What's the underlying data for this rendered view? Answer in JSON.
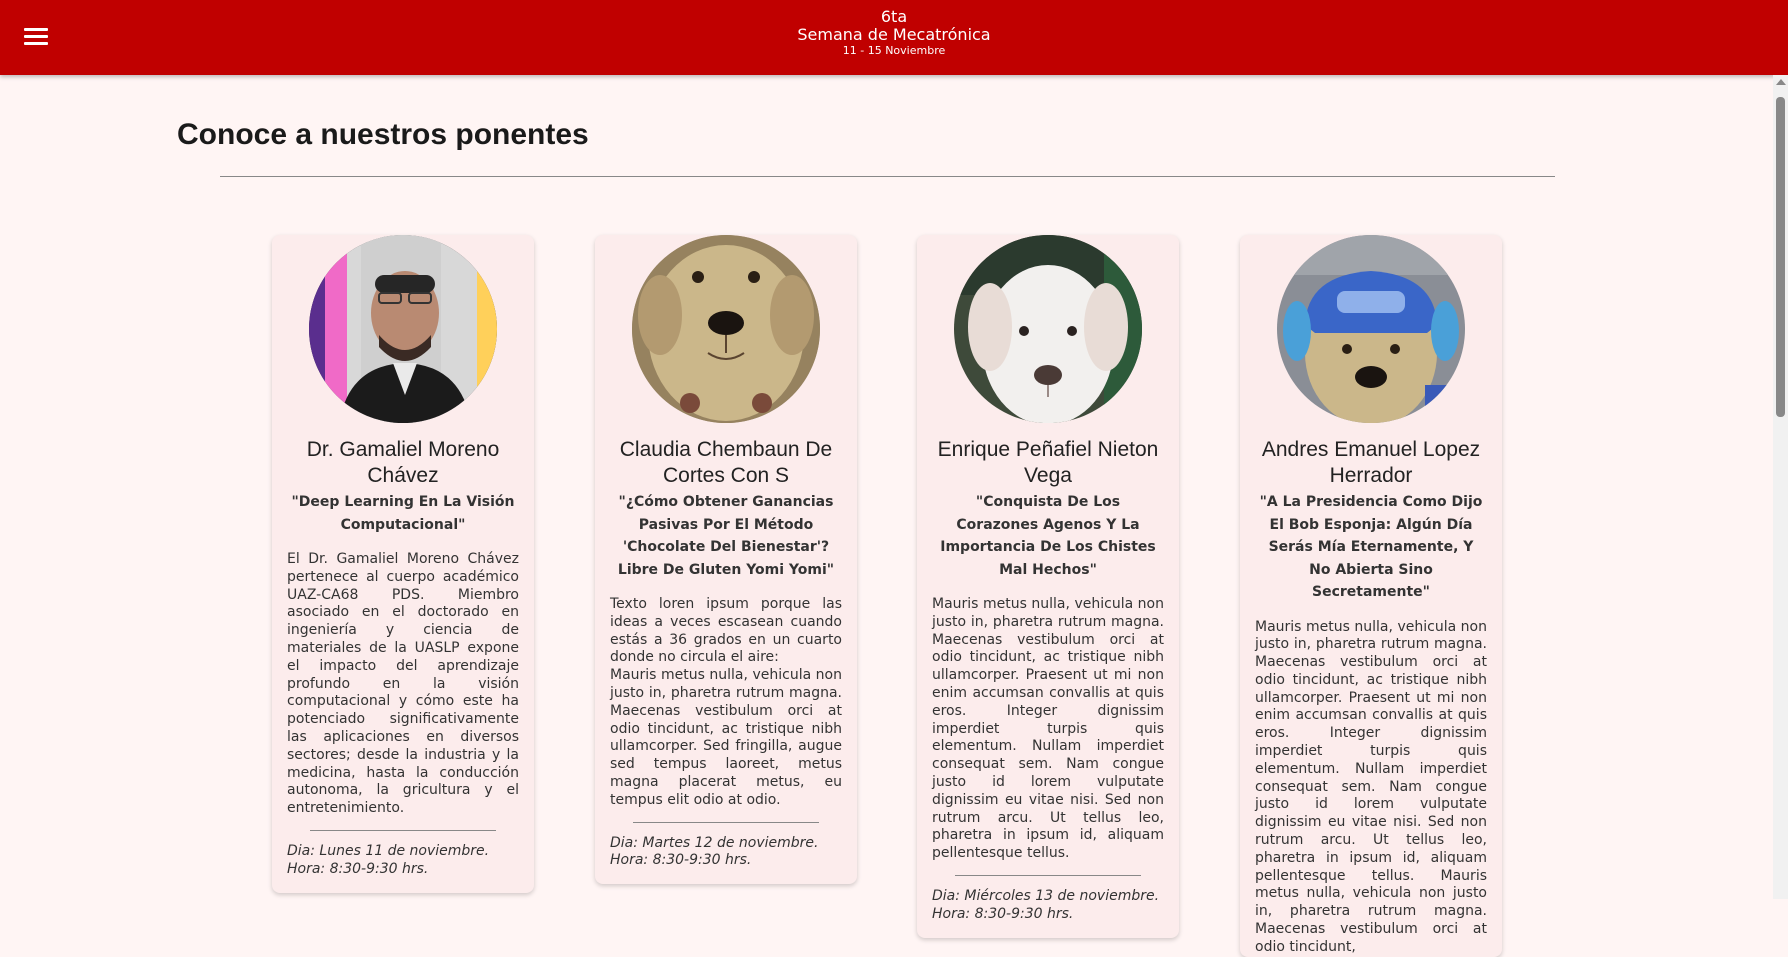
{
  "header": {
    "edition": "6ta",
    "title": "Semana de Mecatrónica",
    "dates": "11 - 15 Noviembre"
  },
  "main": {
    "title": "Conoce a nuestros ponentes"
  },
  "speakers": [
    {
      "name": "Dr. Gamaliel Moreno Chávez",
      "talk": "\"Deep Learning En La Visión Computacional\"",
      "description": "El Dr. Gamaliel Moreno Chávez pertenece al cuerpo académico UAZ-CA68 PDS. Miembro asociado en el doctorado en ingeniería y ciencia de materiales de la UASLP expone el impacto del aprendizaje profundo en la visión computacional y cómo este ha potenciado significativamente las aplicaciones en diversos sectores; desde la industria y la medicina, hasta la conducción autonoma, la gricultura y el entretenimiento.",
      "day": "Dia: Lunes 11 de noviembre.",
      "hour": "Hora: 8:30-9:30 hrs."
    },
    {
      "name": "Claudia Chembaun De Cortes Con S",
      "talk": "\"¿Cómo Obtener Ganancias Pasivas Por El Método 'Chocolate Del Bienestar'? Libre De Gluten Yomi Yomi\"",
      "description": "Texto loren ipsum porque las ideas a veces escasean cuando estás a 36 grados en un cuarto donde no circula el aire:\nMauris metus nulla, vehicula non justo in, pharetra rutrum magna. Maecenas vestibulum orci at odio tincidunt, ac tristique nibh ullamcorper. Sed fringilla, augue sed tempus laoreet, metus magna placerat metus, eu tempus elit odio at odio.",
      "day": "Dia: Martes 12 de noviembre.",
      "hour": "Hora: 8:30-9:30 hrs."
    },
    {
      "name": "Enrique Peñafiel Nieton Vega",
      "talk": "\"Conquista De Los Corazones Agenos Y La Importancia De Los Chistes Mal Hechos\"",
      "description": "Mauris metus nulla, vehicula non justo in, pharetra rutrum magna. Maecenas vestibulum orci at odio tincidunt, ac tristique nibh ullamcorper. Praesent ut mi non enim accumsan convallis at quis eros. Integer dignissim imperdiet turpis quis elementum. Nullam imperdiet consequat sem. Nam congue justo id lorem vulputate dignissim eu vitae nisi. Sed non rutrum arcu. Ut tellus leo, pharetra in ipsum id, aliquam pellentesque tellus.",
      "day": "Dia: Miércoles 13 de noviembre.",
      "hour": "Hora: 8:30-9:30 hrs."
    },
    {
      "name": "Andres Emanuel Lopez Herrador",
      "talk": "\"A La Presidencia Como Dijo El Bob Esponja: Algún Día Serás Mía Eternamente, Y No Abierta Sino Secretamente\"",
      "description": "Mauris metus nulla, vehicula non justo in, pharetra rutrum magna. Maecenas vestibulum orci at odio tincidunt, ac tristique nibh ullamcorper. Praesent ut mi non enim accumsan convallis at quis eros. Integer dignissim imperdiet turpis quis elementum. Nullam imperdiet consequat sem. Nam congue justo id lorem vulputate dignissim eu vitae nisi. Sed non rutrum arcu. Ut tellus leo, pharetra in ipsum id, aliquam pellentesque tellus. Mauris metus nulla, vehicula non justo in, pharetra rutrum magna. Maecenas vestibulum orci at odio tincidunt,"
    }
  ],
  "icons": {
    "menu": "hamburger-menu-icon"
  },
  "colors": {
    "header_bg": "#c00000",
    "page_bg": "#fff5f4",
    "card_bg": "#fcecec"
  }
}
